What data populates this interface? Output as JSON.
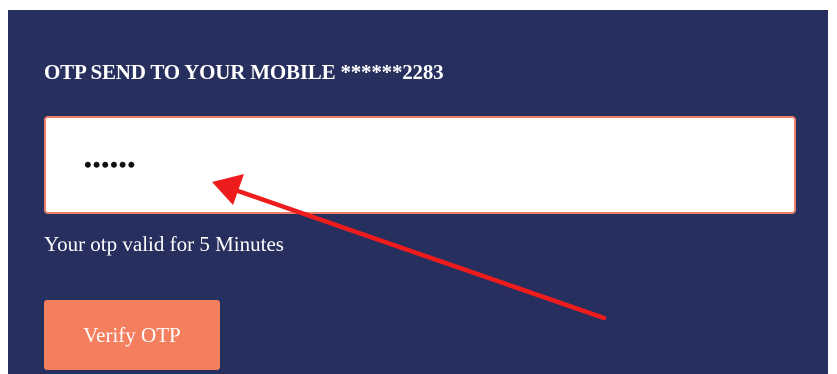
{
  "otp_form": {
    "heading": "OTP SEND TO YOUR MOBILE ******2283",
    "otp_value": "••••••",
    "validity_text": "Your otp valid for 5 Minutes",
    "verify_label": "Verify OTP"
  },
  "colors": {
    "panel_background": "#272f5e",
    "button_background": "#f47f5e",
    "input_border": "#f07f6a",
    "annotation_arrow": "#ee1c1c"
  },
  "annotation": {
    "icon": "red-arrow-icon"
  }
}
